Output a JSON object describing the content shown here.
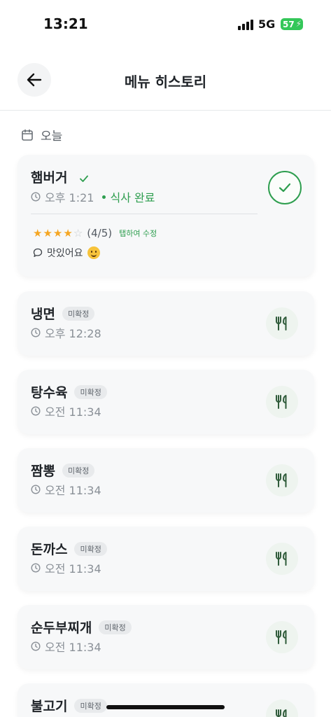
{
  "status_bar": {
    "time": "13:21",
    "network": "5G",
    "battery": "57"
  },
  "header": {
    "title": "메뉴 히스토리"
  },
  "section": {
    "title": "오늘"
  },
  "completed_item": {
    "name": "햄버거",
    "time": "오후 1:21",
    "status": "식사 완료",
    "rating": 4,
    "rating_max": 5,
    "rating_text": "(4/5)",
    "edit_hint": "탭하여 수정",
    "comment": "맛있어요"
  },
  "items": [
    {
      "name": "냉면",
      "badge": "미확정",
      "time": "오후 12:28"
    },
    {
      "name": "탕수육",
      "badge": "미확정",
      "time": "오전 11:34"
    },
    {
      "name": "짬뽕",
      "badge": "미확정",
      "time": "오전 11:34"
    },
    {
      "name": "돈까스",
      "badge": "미확정",
      "time": "오전 11:34"
    },
    {
      "name": "순두부찌개",
      "badge": "미확정",
      "time": "오전 11:34"
    },
    {
      "name": "불고기",
      "badge": "미확정",
      "time": ""
    }
  ],
  "colors": {
    "accent": "#2e9e4f",
    "star": "#f5a623",
    "card_bg": "#f7f8f9",
    "badge_bg": "#e8eaec"
  },
  "icons": [
    "back-arrow-icon",
    "calendar-icon",
    "clock-icon",
    "check-icon",
    "check-circle-icon",
    "star-icon",
    "comment-icon",
    "smile-emoji-icon",
    "utensils-icon"
  ]
}
